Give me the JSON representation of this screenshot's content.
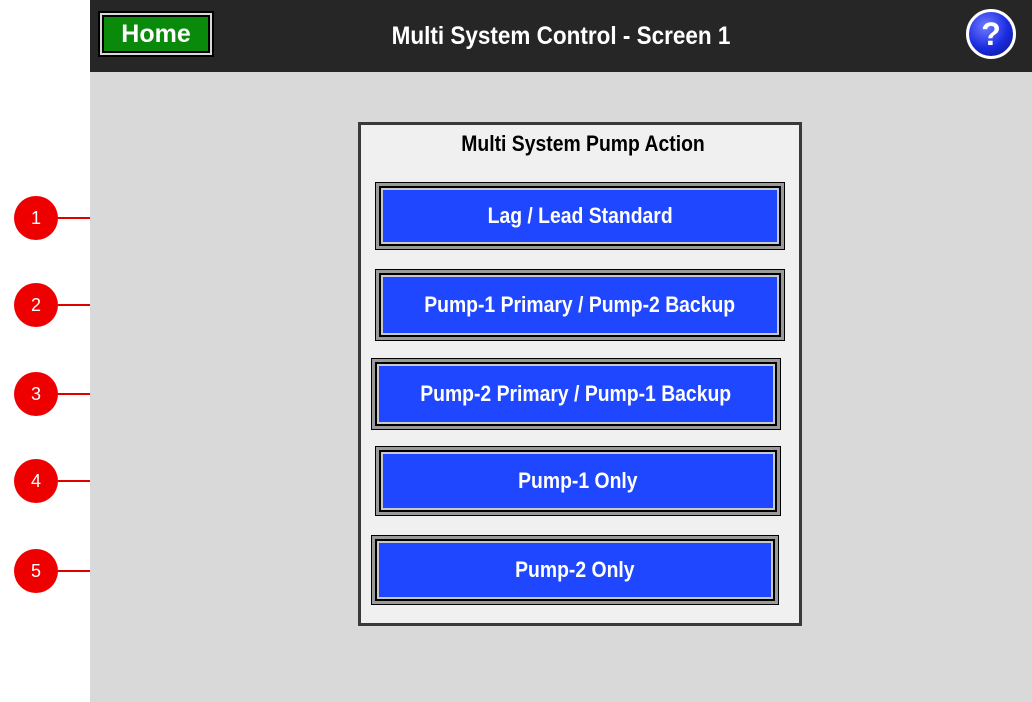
{
  "header": {
    "home_label": "Home",
    "title": "Multi System Control - Screen 1",
    "help_label": "?"
  },
  "panel": {
    "title": "Multi System Pump Action",
    "buttons": [
      {
        "label": "Lag / Lead Standard"
      },
      {
        "label": "Pump-1 Primary / Pump-2 Backup"
      },
      {
        "label": "Pump-2 Primary / Pump-1 Backup"
      },
      {
        "label": "Pump-1 Only"
      },
      {
        "label": "Pump-2 Only"
      }
    ]
  },
  "callouts": [
    "1",
    "2",
    "3",
    "4",
    "5"
  ],
  "colors": {
    "header_bg": "#262626",
    "screen_bg": "#d9d9d9",
    "home_button": "#0a8a0a",
    "pump_button": "#1f47ff",
    "callout": "#ee0000",
    "help_icon": "#1a2be0"
  },
  "icons": {
    "help": "question-circle-icon"
  }
}
